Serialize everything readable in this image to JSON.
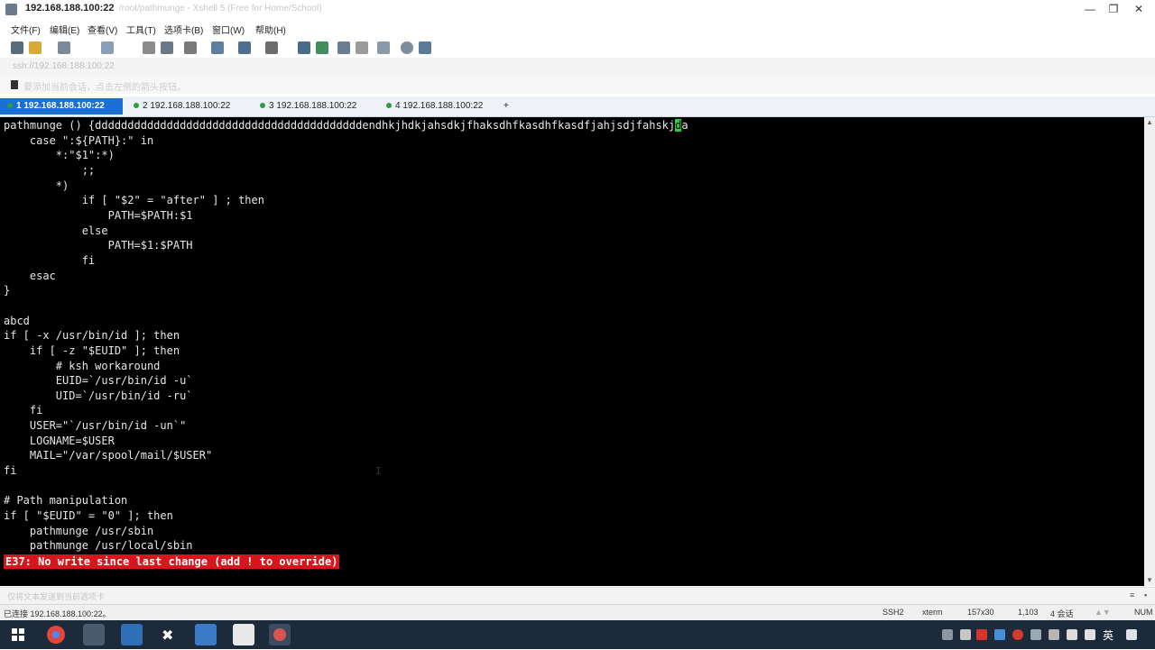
{
  "window": {
    "title": "192.168.188.100:22",
    "subtitle": "/root/pathmunge - Xshell 5 (Free for Home/School)",
    "controls": [
      "—",
      "❐",
      "✕"
    ]
  },
  "menu": {
    "items": [
      "文件(F)",
      "编辑(E)",
      "查看(V)",
      "工具(T)",
      "选项卡(B)",
      "窗口(W)",
      "帮助(H)"
    ]
  },
  "address": {
    "value": "ssh://192.168.188.100:22"
  },
  "hint": {
    "text": "要添加当前会话，点击左侧的箭头按钮。"
  },
  "tabs": [
    {
      "label": "1 192.168.188.100:22",
      "active": true
    },
    {
      "label": "2 192.168.188.100:22",
      "active": false
    },
    {
      "label": "3 192.168.188.100:22",
      "active": false
    },
    {
      "label": "4 192.168.188.100:22",
      "active": false
    }
  ],
  "tab_add": "+",
  "terminal": {
    "first_line_before_cursor": "pathmunge () {dddddddddddddddddddddddddddddddddddddddddendhkjhdkjahsdkjfhaksdhfkasdhfkasdfjahjsdjfahskj",
    "cursor_char": "d",
    "first_line_after_cursor": "a",
    "lines": "    case \":${PATH}:\" in\n        *:\"$1\":*)\n            ;;\n        *)\n            if [ \"$2\" = \"after\" ] ; then\n                PATH=$PATH:$1\n            else\n                PATH=$1:$PATH\n            fi\n    esac\n}\n\nabcd\nif [ -x /usr/bin/id ]; then\n    if [ -z \"$EUID\" ]; then\n        # ksh workaround\n        EUID=`/usr/bin/id -u`\n        UID=`/usr/bin/id -ru`\n    fi\n    USER=\"`/usr/bin/id -un`\"\n    LOGNAME=$USER\n    MAIL=\"/var/spool/mail/$USER\"\nfi\n\n# Path manipulation\nif [ \"$EUID\" = \"0\" ]; then\n    pathmunge /usr/sbin\n    pathmunge /usr/local/sbin",
    "error": "E37: No write since last change (add ! to override)",
    "text_cursor": "I"
  },
  "compose": {
    "text": "仅将文本发送到当前选项卡"
  },
  "status": {
    "connection": "已连接 192.168.188.100:22。",
    "protocol": "SSH2",
    "terminal_type": "xterm",
    "size": "157x30",
    "position": "1,103",
    "sessions": "4 会话",
    "numlock": "NUM"
  },
  "taskbar": {
    "ime": "英",
    "apps": [
      "windows-start-icon",
      "chrome-icon",
      "terminal-icon",
      "window-manager-icon",
      "xshell-icon",
      "explorer-icon",
      "notepad-icon",
      "xftp-icon"
    ]
  },
  "colors": {
    "terminal_bg": "#000000",
    "terminal_fg": "#e6e6e6",
    "error_bg": "#d8141c",
    "cursor": "#2ecc40",
    "active_tab": "#1a6fd4",
    "taskbar": "#1c2a3a"
  }
}
